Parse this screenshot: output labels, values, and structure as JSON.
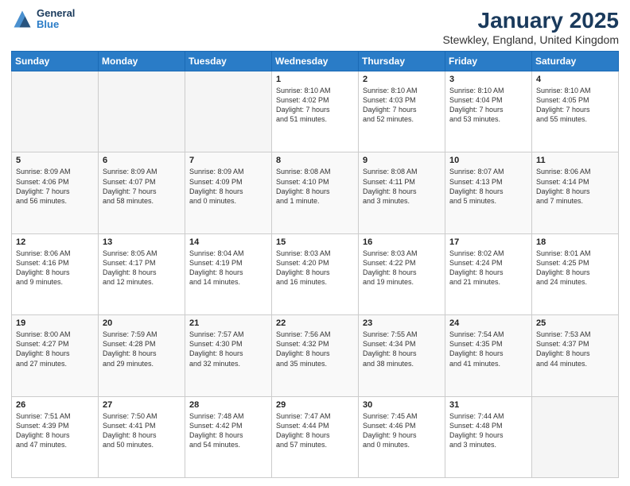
{
  "header": {
    "logo_line1": "General",
    "logo_line2": "Blue",
    "title": "January 2025",
    "subtitle": "Stewkley, England, United Kingdom"
  },
  "weekdays": [
    "Sunday",
    "Monday",
    "Tuesday",
    "Wednesday",
    "Thursday",
    "Friday",
    "Saturday"
  ],
  "weeks": [
    [
      {
        "day": "",
        "info": ""
      },
      {
        "day": "",
        "info": ""
      },
      {
        "day": "",
        "info": ""
      },
      {
        "day": "1",
        "info": "Sunrise: 8:10 AM\nSunset: 4:02 PM\nDaylight: 7 hours\nand 51 minutes."
      },
      {
        "day": "2",
        "info": "Sunrise: 8:10 AM\nSunset: 4:03 PM\nDaylight: 7 hours\nand 52 minutes."
      },
      {
        "day": "3",
        "info": "Sunrise: 8:10 AM\nSunset: 4:04 PM\nDaylight: 7 hours\nand 53 minutes."
      },
      {
        "day": "4",
        "info": "Sunrise: 8:10 AM\nSunset: 4:05 PM\nDaylight: 7 hours\nand 55 minutes."
      }
    ],
    [
      {
        "day": "5",
        "info": "Sunrise: 8:09 AM\nSunset: 4:06 PM\nDaylight: 7 hours\nand 56 minutes."
      },
      {
        "day": "6",
        "info": "Sunrise: 8:09 AM\nSunset: 4:07 PM\nDaylight: 7 hours\nand 58 minutes."
      },
      {
        "day": "7",
        "info": "Sunrise: 8:09 AM\nSunset: 4:09 PM\nDaylight: 8 hours\nand 0 minutes."
      },
      {
        "day": "8",
        "info": "Sunrise: 8:08 AM\nSunset: 4:10 PM\nDaylight: 8 hours\nand 1 minute."
      },
      {
        "day": "9",
        "info": "Sunrise: 8:08 AM\nSunset: 4:11 PM\nDaylight: 8 hours\nand 3 minutes."
      },
      {
        "day": "10",
        "info": "Sunrise: 8:07 AM\nSunset: 4:13 PM\nDaylight: 8 hours\nand 5 minutes."
      },
      {
        "day": "11",
        "info": "Sunrise: 8:06 AM\nSunset: 4:14 PM\nDaylight: 8 hours\nand 7 minutes."
      }
    ],
    [
      {
        "day": "12",
        "info": "Sunrise: 8:06 AM\nSunset: 4:16 PM\nDaylight: 8 hours\nand 9 minutes."
      },
      {
        "day": "13",
        "info": "Sunrise: 8:05 AM\nSunset: 4:17 PM\nDaylight: 8 hours\nand 12 minutes."
      },
      {
        "day": "14",
        "info": "Sunrise: 8:04 AM\nSunset: 4:19 PM\nDaylight: 8 hours\nand 14 minutes."
      },
      {
        "day": "15",
        "info": "Sunrise: 8:03 AM\nSunset: 4:20 PM\nDaylight: 8 hours\nand 16 minutes."
      },
      {
        "day": "16",
        "info": "Sunrise: 8:03 AM\nSunset: 4:22 PM\nDaylight: 8 hours\nand 19 minutes."
      },
      {
        "day": "17",
        "info": "Sunrise: 8:02 AM\nSunset: 4:24 PM\nDaylight: 8 hours\nand 21 minutes."
      },
      {
        "day": "18",
        "info": "Sunrise: 8:01 AM\nSunset: 4:25 PM\nDaylight: 8 hours\nand 24 minutes."
      }
    ],
    [
      {
        "day": "19",
        "info": "Sunrise: 8:00 AM\nSunset: 4:27 PM\nDaylight: 8 hours\nand 27 minutes."
      },
      {
        "day": "20",
        "info": "Sunrise: 7:59 AM\nSunset: 4:28 PM\nDaylight: 8 hours\nand 29 minutes."
      },
      {
        "day": "21",
        "info": "Sunrise: 7:57 AM\nSunset: 4:30 PM\nDaylight: 8 hours\nand 32 minutes."
      },
      {
        "day": "22",
        "info": "Sunrise: 7:56 AM\nSunset: 4:32 PM\nDaylight: 8 hours\nand 35 minutes."
      },
      {
        "day": "23",
        "info": "Sunrise: 7:55 AM\nSunset: 4:34 PM\nDaylight: 8 hours\nand 38 minutes."
      },
      {
        "day": "24",
        "info": "Sunrise: 7:54 AM\nSunset: 4:35 PM\nDaylight: 8 hours\nand 41 minutes."
      },
      {
        "day": "25",
        "info": "Sunrise: 7:53 AM\nSunset: 4:37 PM\nDaylight: 8 hours\nand 44 minutes."
      }
    ],
    [
      {
        "day": "26",
        "info": "Sunrise: 7:51 AM\nSunset: 4:39 PM\nDaylight: 8 hours\nand 47 minutes."
      },
      {
        "day": "27",
        "info": "Sunrise: 7:50 AM\nSunset: 4:41 PM\nDaylight: 8 hours\nand 50 minutes."
      },
      {
        "day": "28",
        "info": "Sunrise: 7:48 AM\nSunset: 4:42 PM\nDaylight: 8 hours\nand 54 minutes."
      },
      {
        "day": "29",
        "info": "Sunrise: 7:47 AM\nSunset: 4:44 PM\nDaylight: 8 hours\nand 57 minutes."
      },
      {
        "day": "30",
        "info": "Sunrise: 7:45 AM\nSunset: 4:46 PM\nDaylight: 9 hours\nand 0 minutes."
      },
      {
        "day": "31",
        "info": "Sunrise: 7:44 AM\nSunset: 4:48 PM\nDaylight: 9 hours\nand 3 minutes."
      },
      {
        "day": "",
        "info": ""
      }
    ]
  ]
}
